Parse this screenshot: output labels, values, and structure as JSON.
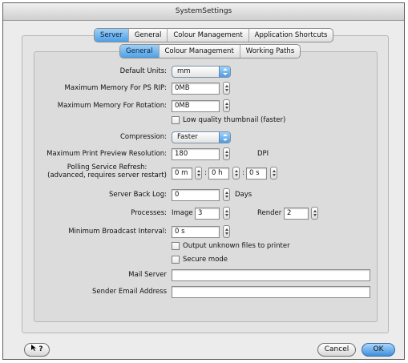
{
  "window": {
    "title": "SystemSettings"
  },
  "top_tabs": [
    {
      "label": "Server",
      "selected": true
    },
    {
      "label": "General",
      "selected": false
    },
    {
      "label": "Colour Management",
      "selected": false
    },
    {
      "label": "Application Shortcuts",
      "selected": false
    }
  ],
  "sub_tabs": [
    {
      "label": "General",
      "selected": true
    },
    {
      "label": "Colour Management",
      "selected": false
    },
    {
      "label": "Working Paths",
      "selected": false
    }
  ],
  "fields": {
    "default_units": {
      "label": "Default Units:",
      "value": "mm"
    },
    "max_memory_ps_rip": {
      "label": "Maximum Memory For PS RIP:",
      "value": "0MB"
    },
    "max_memory_rotation": {
      "label": "Maximum Memory For Rotation:",
      "value": "0MB"
    },
    "low_quality_thumbnail": {
      "label": "Low quality thumbnail (faster)",
      "checked": false
    },
    "compression": {
      "label": "Compression:",
      "value": "Faster"
    },
    "max_print_preview": {
      "label": "Maximum Print Preview Resolution:",
      "value": "180",
      "unit": "DPI"
    },
    "polling_refresh": {
      "label_line1": "Polling Service Refresh:",
      "label_line2": "(advanced, requires server restart)",
      "minutes": "0 m",
      "hours": "0 h",
      "seconds": "0 s",
      "sep1": ":",
      "sep2": ":"
    },
    "server_back_log": {
      "label": "Server Back Log:",
      "value": "0",
      "unit": "Days"
    },
    "processes": {
      "label": "Processes:",
      "image_label": "Image",
      "image_value": "3",
      "render_label": "Render",
      "render_value": "2"
    },
    "min_broadcast_interval": {
      "label": "Minimum Broadcast Interval:",
      "value": "0 s"
    },
    "output_unknown_files": {
      "label": "Output unknown files to printer",
      "checked": false
    },
    "secure_mode": {
      "label": "Secure mode",
      "checked": false
    },
    "mail_server": {
      "label": "Mail Server",
      "value": ""
    },
    "sender_email": {
      "label": "Sender Email Address",
      "value": ""
    }
  },
  "buttons": {
    "help": "?",
    "cancel": "Cancel",
    "ok": "OK"
  },
  "colors": {
    "accent_blue": "#4f9fe6",
    "window_bg": "#ececec"
  }
}
